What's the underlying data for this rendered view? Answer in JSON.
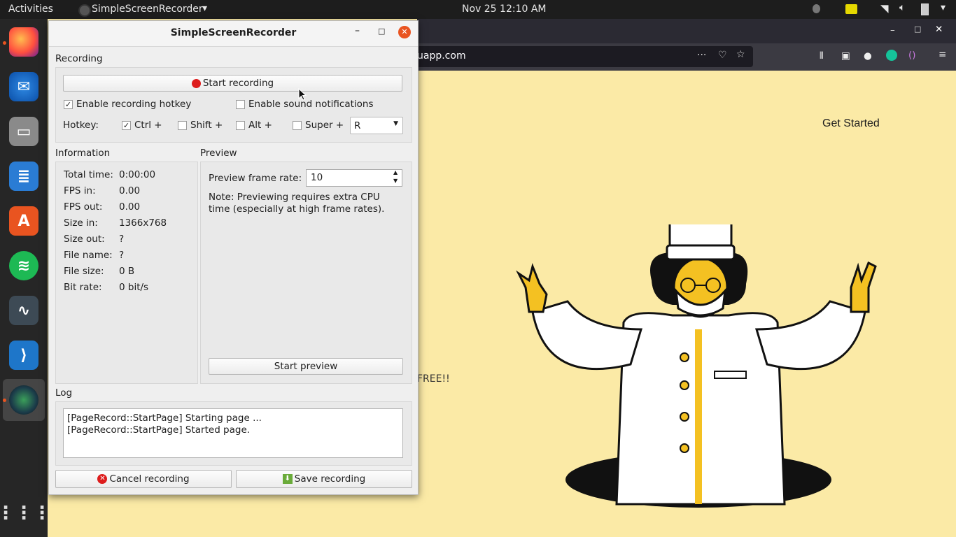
{
  "topbar": {
    "activities": "Activities",
    "app_name": "SimpleScreenRecorder",
    "clock": "Nov 25  12:10 AM"
  },
  "browser": {
    "url_fragment": "uapp.com",
    "get_started": "Get Started",
    "free_text": "FREE!!"
  },
  "recorder": {
    "title": "SimpleScreenRecorder",
    "recording": {
      "section": "Recording",
      "start_button": "Start recording",
      "hotkey_label": "Enable recording hotkey",
      "hotkey_enabled": true,
      "sound_label": "Enable sound notifications",
      "sound_enabled": false,
      "hotkey_row_label": "Hotkey:",
      "ctrl": "Ctrl +",
      "shift": "Shift +",
      "alt": "Alt +",
      "super": "Super +",
      "key": "R"
    },
    "information": {
      "section": "Information",
      "rows": [
        {
          "key": "Total time:",
          "value": "0:00:00"
        },
        {
          "key": "FPS in:",
          "value": "0.00"
        },
        {
          "key": "FPS out:",
          "value": "0.00"
        },
        {
          "key": "Size in:",
          "value": "1366x768"
        },
        {
          "key": "Size out:",
          "value": "?"
        },
        {
          "key": "File name:",
          "value": "?"
        },
        {
          "key": "File size:",
          "value": "0 B"
        },
        {
          "key": "Bit rate:",
          "value": "0 bit/s"
        }
      ]
    },
    "preview": {
      "section": "Preview",
      "frame_rate_label": "Preview frame rate:",
      "frame_rate_value": "10",
      "note_line1": "Note: Previewing requires extra CPU",
      "note_line2": "time (especially at high frame rates).",
      "start_button": "Start preview"
    },
    "log": {
      "section": "Log",
      "lines": [
        "[PageRecord::StartPage] Starting page ...",
        "[PageRecord::StartPage] Started page."
      ]
    },
    "cancel_button": "Cancel recording",
    "save_button": "Save recording"
  },
  "colors": {
    "accent": "#e95420",
    "web_background": "#fbeaa6",
    "record_red": "#dd1c1c"
  }
}
